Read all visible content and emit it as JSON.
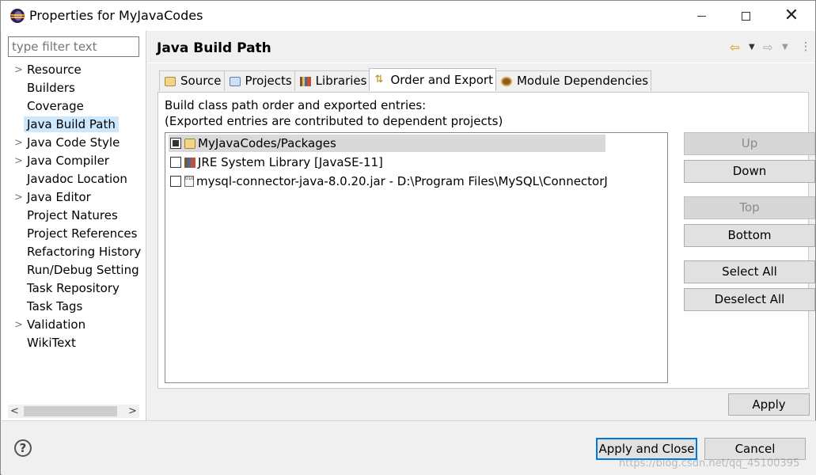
{
  "window": {
    "title": "Properties for MyJavaCodes",
    "icon": "eclipse-icon"
  },
  "sidebar": {
    "filter_placeholder": "type filter text",
    "items": [
      {
        "label": "Resource",
        "expandable": true
      },
      {
        "label": "Builders",
        "expandable": false
      },
      {
        "label": "Coverage",
        "expandable": false
      },
      {
        "label": "Java Build Path",
        "expandable": false,
        "selected": true
      },
      {
        "label": "Java Code Style",
        "expandable": true
      },
      {
        "label": "Java Compiler",
        "expandable": true
      },
      {
        "label": "Javadoc Location",
        "expandable": false
      },
      {
        "label": "Java Editor",
        "expandable": true
      },
      {
        "label": "Project Natures",
        "expandable": false
      },
      {
        "label": "Project References",
        "expandable": false
      },
      {
        "label": "Refactoring History",
        "expandable": false
      },
      {
        "label": "Run/Debug Setting",
        "expandable": false
      },
      {
        "label": "Task Repository",
        "expandable": false
      },
      {
        "label": "Task Tags",
        "expandable": false
      },
      {
        "label": "Validation",
        "expandable": true
      },
      {
        "label": "WikiText",
        "expandable": false
      }
    ]
  },
  "main": {
    "title": "Java Build Path",
    "tabs": [
      {
        "label": "Source",
        "icon": "source-folder-icon"
      },
      {
        "label": "Projects",
        "icon": "projects-icon"
      },
      {
        "label": "Libraries",
        "icon": "libraries-icon"
      },
      {
        "label": "Order and Export",
        "icon": "order-export-icon",
        "active": true
      },
      {
        "label": "Module Dependencies",
        "icon": "module-icon"
      }
    ],
    "description_line1": "Build class path order and exported entries:",
    "description_line2": "(Exported entries are contributed to dependent projects)",
    "entries": [
      {
        "label": "MyJavaCodes/Packages",
        "checked": "indeterminate",
        "icon": "package-folder-icon"
      },
      {
        "label": "JRE System Library [JavaSE-11]",
        "checked": false,
        "icon": "jre-library-icon"
      },
      {
        "label": "mysql-connector-java-8.0.20.jar - D:\\Program Files\\MySQL\\ConnectorJ",
        "checked": false,
        "icon": "jar-icon"
      }
    ],
    "buttons": {
      "up": "Up",
      "down": "Down",
      "top": "Top",
      "bottom": "Bottom",
      "select_all": "Select All",
      "deselect_all": "Deselect All"
    },
    "apply": "Apply"
  },
  "footer": {
    "apply_close": "Apply and Close",
    "cancel": "Cancel",
    "watermark": "https://blog.csdn.net/qq_45100395"
  }
}
